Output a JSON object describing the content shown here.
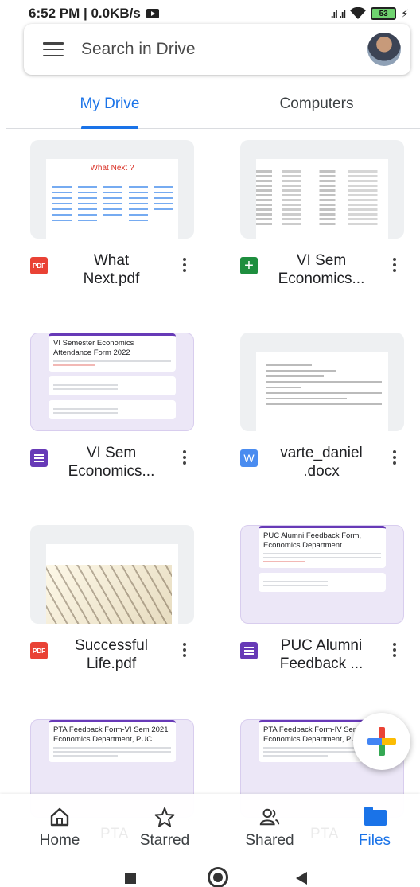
{
  "status_bar": {
    "time_speed": "6:52 PM | 0.0KB/s",
    "signal": "..ıl ..ıl",
    "wifi": "▲",
    "battery": "53"
  },
  "search": {
    "placeholder": "Search in Drive"
  },
  "tabs": [
    {
      "label": "My Drive",
      "active": true
    },
    {
      "label": "Computers",
      "active": false
    }
  ],
  "files": [
    {
      "name_line1": "What",
      "name_line2": "Next.pdf",
      "type": "pdf",
      "icon_label": "PDF"
    },
    {
      "name_line1": "VI Sem",
      "name_line2": "Economics...",
      "type": "sheet",
      "icon_label": "+"
    },
    {
      "name_line1": "VI Sem",
      "name_line2": "Economics...",
      "type": "form",
      "icon_label": ""
    },
    {
      "name_line1": "varte_daniel",
      "name_line2": ".docx",
      "type": "word",
      "icon_label": "W"
    },
    {
      "name_line1": "Successful",
      "name_line2": "Life.pdf",
      "type": "pdf",
      "icon_label": "PDF"
    },
    {
      "name_line1": "PUC Alumni",
      "name_line2": "Feedback ...",
      "type": "form",
      "icon_label": ""
    }
  ],
  "thumbnails": {
    "what_next_title": "What Next ?",
    "form1_title": "VI Semester Economics Attendance Form 2022",
    "puc_title": "PUC Alumni Feedback Form, Economics Department",
    "pta1_title": "PTA Feedback Form-VI Sem 2021 Economics Department, PUC",
    "pta2_title": "PTA Feedback Form-IV Sem 2022 Economics Department, PUC"
  },
  "bottom_nav": [
    {
      "label": "Home",
      "icon": "home-icon",
      "active": false
    },
    {
      "label": "Starred",
      "icon": "star-icon",
      "active": false
    },
    {
      "label": "Shared",
      "icon": "people-icon",
      "active": false
    },
    {
      "label": "Files",
      "icon": "folder-icon",
      "active": true
    }
  ],
  "ghost_labels": [
    "PTA",
    "PTA"
  ],
  "colors": {
    "accent": "#1a73e8",
    "pdf": "#e94235",
    "sheet": "#1e8e3e",
    "form": "#673ab7",
    "word": "#4a8cf0"
  }
}
